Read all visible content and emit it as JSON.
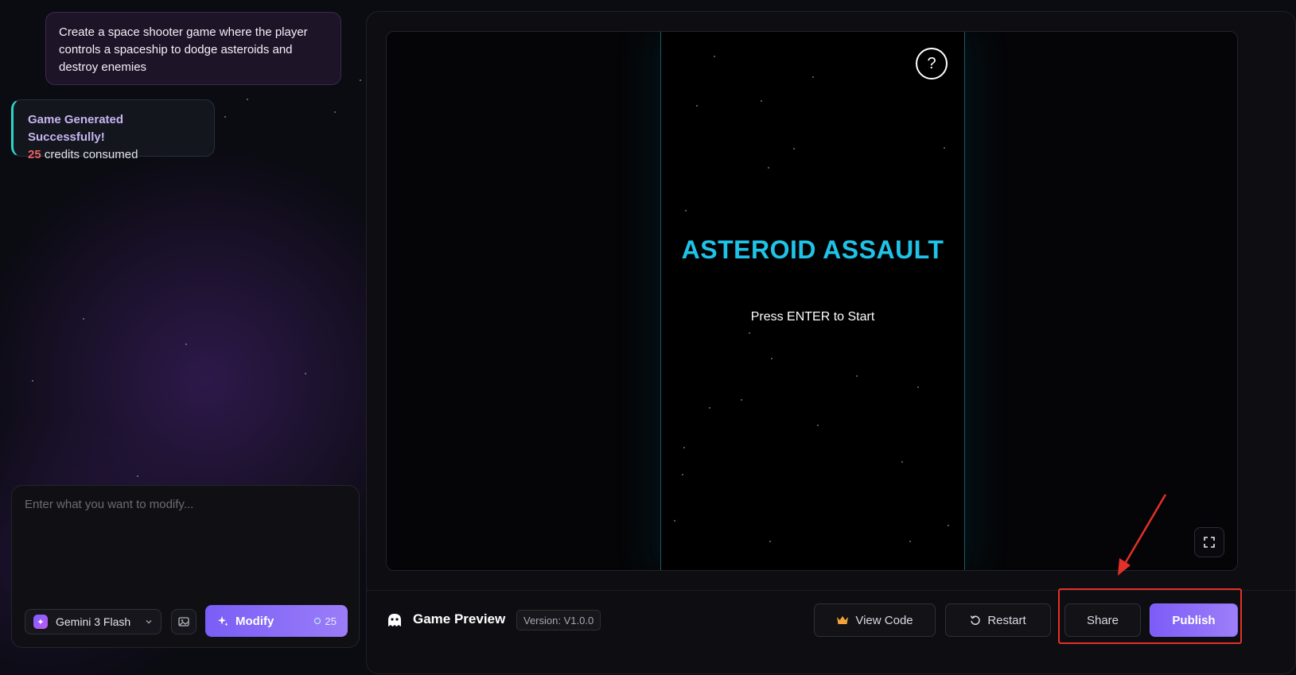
{
  "chat": {
    "prompt_text": "Create a space shooter game where the player controls a spaceship to dodge asteroids and destroy enemies",
    "success_title": "Game Generated Successfully!",
    "credits_amount": "25",
    "credits_label": "credits consumed"
  },
  "modify": {
    "placeholder": "Enter what you want to modify...",
    "model_name": "Gemini 3 Flash",
    "model_icon": "sparkle-icon",
    "image_icon": "image-icon",
    "button_label": "Modify",
    "cost": "25"
  },
  "game": {
    "title": "ASTEROID ASSAULT",
    "subtitle": "Press ENTER to Start",
    "help_label": "?",
    "title_color": "#1fc3e8"
  },
  "toolbar": {
    "preview_label": "Game Preview",
    "version": "Version: V1.0.0",
    "view_code_label": "View Code",
    "restart_label": "Restart",
    "share_label": "Share",
    "publish_label": "Publish"
  },
  "colors": {
    "accent": "#8b6cf8",
    "success_border": "#2dd4c7",
    "credits_red": "#ef5f63",
    "annotation_red": "#e33028"
  }
}
